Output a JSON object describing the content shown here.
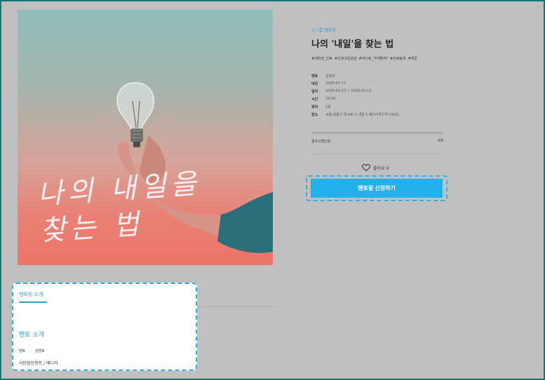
{
  "poster": {
    "handwriting_lines": "나의 내일을\n찾는 법",
    "description_icon": "lightbulb-hand-icon"
  },
  "details": {
    "category": "소그룹 멘토링",
    "title": "나의 '내일'을 찾는 법",
    "tags": [
      "#대학생_진로",
      "#인생고민상담",
      "#어디로_가야할까?",
      "#진로탐색",
      "#취준"
    ],
    "info": [
      {
        "key": "멘토",
        "value": "김멘토"
      },
      {
        "key": "마감",
        "value": "2020-02-12"
      },
      {
        "key": "일자",
        "value": "2020-02-13 ~ 2020-02-13"
      },
      {
        "key": "시간",
        "value": "18:30"
      },
      {
        "key": "회차",
        "value": "1회"
      },
      {
        "key": "장소",
        "value": "서울 성동구 독서로 1 내일 5 에이가루27F G501"
      }
    ],
    "apply_label": "접수신청인원",
    "apply_count": "0/8",
    "apply_progress": 0,
    "like_label": "좋아요 0",
    "cta_label": "멘토링 신청하기"
  },
  "intro": {
    "tab_label": "멘토링 소개",
    "section_title": "멘토 소개",
    "mentor_key": "멘토",
    "mentor_name": "김멘토",
    "company": "사단법인청프 / 매니저"
  },
  "colors": {
    "accent": "#21b0ea",
    "frame": "#0d7a72",
    "backdrop": "#c0c0c0"
  }
}
